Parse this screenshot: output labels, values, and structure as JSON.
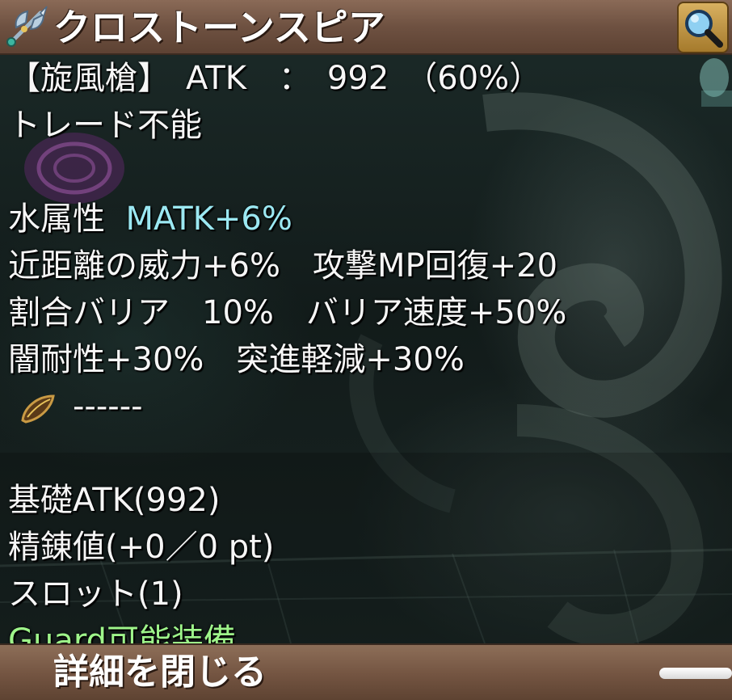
{
  "colors": {
    "title_bar": "#6e5141",
    "stat_highlight": "#9be8f2",
    "guard_text": "#9ef58a",
    "text": "#f6f6f6",
    "button_gold": "#c99a44"
  },
  "header": {
    "title": "クロストーンスピア",
    "weapon_icon": "spear-axe-icon",
    "magnifier_icon": "magnifier-icon"
  },
  "item": {
    "type_line": "【旋風槍】　ATK　：　992　（60%）",
    "trade_status": "トレード不能",
    "element_label": "水属性",
    "element_bonus": "MATK+6%",
    "stats": [
      "近距離の威力+6%　攻撃MP回復+20",
      "割合バリア　10%　バリア速度+50%",
      "闇耐性+30%　突進軽減+30%"
    ],
    "card_slot": {
      "icon": "card-slot-icon",
      "text": "------"
    },
    "base_atk": "基礎ATK(992)",
    "refine": "精錬値(+0／0 pt)",
    "slots": "スロット(1)",
    "guard": "Guard可能装備"
  },
  "footer": {
    "close_label": "詳細を閉じる"
  }
}
